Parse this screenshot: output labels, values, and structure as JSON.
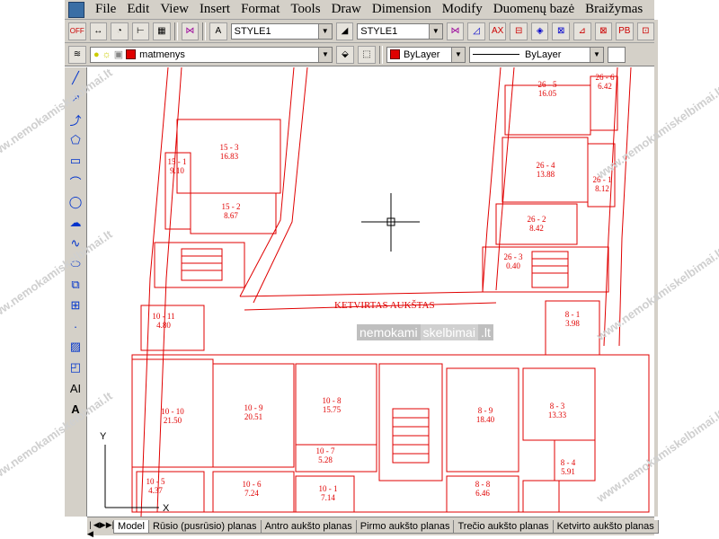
{
  "menu": {
    "items": [
      "File",
      "Edit",
      "View",
      "Insert",
      "Format",
      "Tools",
      "Draw",
      "Dimension",
      "Modify",
      "Duomenų bazė",
      "Braižymas"
    ]
  },
  "toolbar": {
    "text_style": "STYLE1",
    "dim_style": "STYLE1"
  },
  "properties": {
    "layer": "matmenys",
    "color": "ByLayer",
    "linetype": "ByLayer",
    "accent_color": "#e00000"
  },
  "drawing": {
    "title": "KETVIRTAS AUKŠTAS",
    "axis_y": "Y",
    "axis_x": "X",
    "rooms": [
      {
        "id": "15 - 3",
        "area": "16.83"
      },
      {
        "id": "15 - 1",
        "area": "9.10"
      },
      {
        "id": "15 - 2",
        "area": "8.67"
      },
      {
        "id": "26 - 5",
        "area": "16.05"
      },
      {
        "id": "26 - 6",
        "area": "6.42"
      },
      {
        "id": "26 - 4",
        "area": "13.88"
      },
      {
        "id": "26 - 1",
        "area": "8.12"
      },
      {
        "id": "26 - 2",
        "area": "8.42"
      },
      {
        "id": "26 - 3",
        "area": "0.40"
      },
      {
        "id": "10 - 11",
        "area": "4.80"
      },
      {
        "id": "8 - 1",
        "area": "3.98"
      },
      {
        "id": "10 - 10",
        "area": "21.50"
      },
      {
        "id": "10 - 9",
        "area": "20.51"
      },
      {
        "id": "10 - 8",
        "area": "15.75"
      },
      {
        "id": "10 - 7",
        "area": "5.28"
      },
      {
        "id": "8 - 9",
        "area": "18.40"
      },
      {
        "id": "8 - 3",
        "area": "13.33"
      },
      {
        "id": "8 - 4",
        "area": "5.91"
      },
      {
        "id": "10 - 5",
        "area": "4.37"
      },
      {
        "id": "10 - 6",
        "area": "7.24"
      },
      {
        "id": "10 - 1",
        "area": "7.14"
      },
      {
        "id": "8 - 8",
        "area": "6.46"
      }
    ],
    "watermark": [
      "www.nemokamiskelbimai.lt"
    ],
    "center_watermark": {
      "part1": "nemokami",
      "part2": "skelbimai",
      "part3": ".lt"
    }
  },
  "tabs": [
    "Model",
    "Rūsio (pusrūsio) planas",
    "Antro aukšto planas",
    "Pirmo aukšto planas",
    "Trečio aukšto planas",
    "Ketvirto aukšto planas"
  ]
}
